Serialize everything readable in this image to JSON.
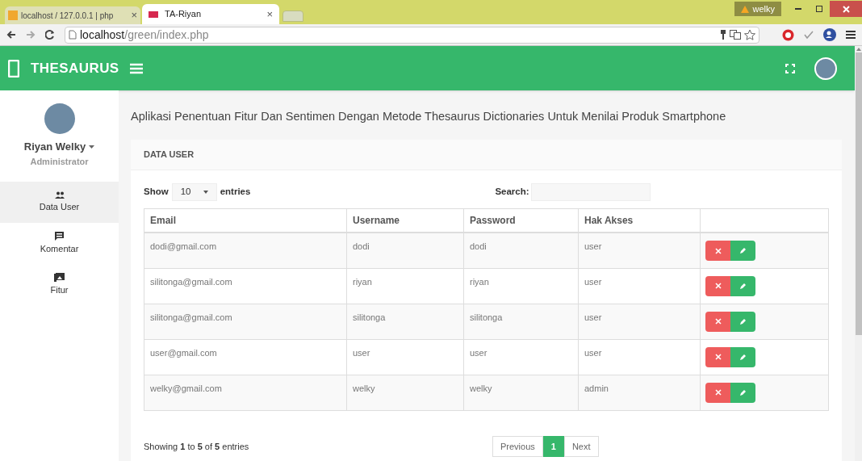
{
  "browser": {
    "tabs": [
      {
        "title": "localhost / 127.0.0.1 | php",
        "close": "×",
        "selected": false
      },
      {
        "title": "TA-Riyan",
        "close": "×",
        "selected": true
      }
    ],
    "profile": "welky",
    "url_host": "localhost",
    "url_path": "/green/index.php"
  },
  "header": {
    "brand": "THESAURUS"
  },
  "sidebar": {
    "user": "Riyan Welky",
    "role": "Administrator",
    "items": [
      {
        "label": "Data User",
        "selected": true
      },
      {
        "label": "Komentar",
        "selected": false
      },
      {
        "label": "Fitur",
        "selected": false
      }
    ]
  },
  "page_title": "Aplikasi Penentuan Fitur Dan Sentimen Dengan Metode Thesaurus Dictionaries Untuk Menilai Produk Smartphone",
  "card_title": "DATA USER",
  "length": {
    "show": "Show",
    "value": "10",
    "entries": "entries"
  },
  "search": {
    "label": "Search:"
  },
  "table": {
    "columns": [
      "Email",
      "Username",
      "Password",
      "Hak Akses"
    ],
    "rows": [
      [
        "dodi@gmail.com",
        "dodi",
        "dodi",
        "user"
      ],
      [
        "silitonga@gmail.com",
        "riyan",
        "riyan",
        "user"
      ],
      [
        "silitonga@gmail.com",
        "silitonga",
        "silitonga",
        "user"
      ],
      [
        "user@gmail.com",
        "user",
        "user",
        "user"
      ],
      [
        "welky@gmail.com",
        "welky",
        "welky",
        "admin"
      ]
    ]
  },
  "info": "Showing **1** to **5** of **5** entries",
  "pagination": [
    {
      "label": "Previous",
      "selected": false
    },
    {
      "label": "1",
      "selected": true
    },
    {
      "label": "Next",
      "selected": false
    }
  ]
}
